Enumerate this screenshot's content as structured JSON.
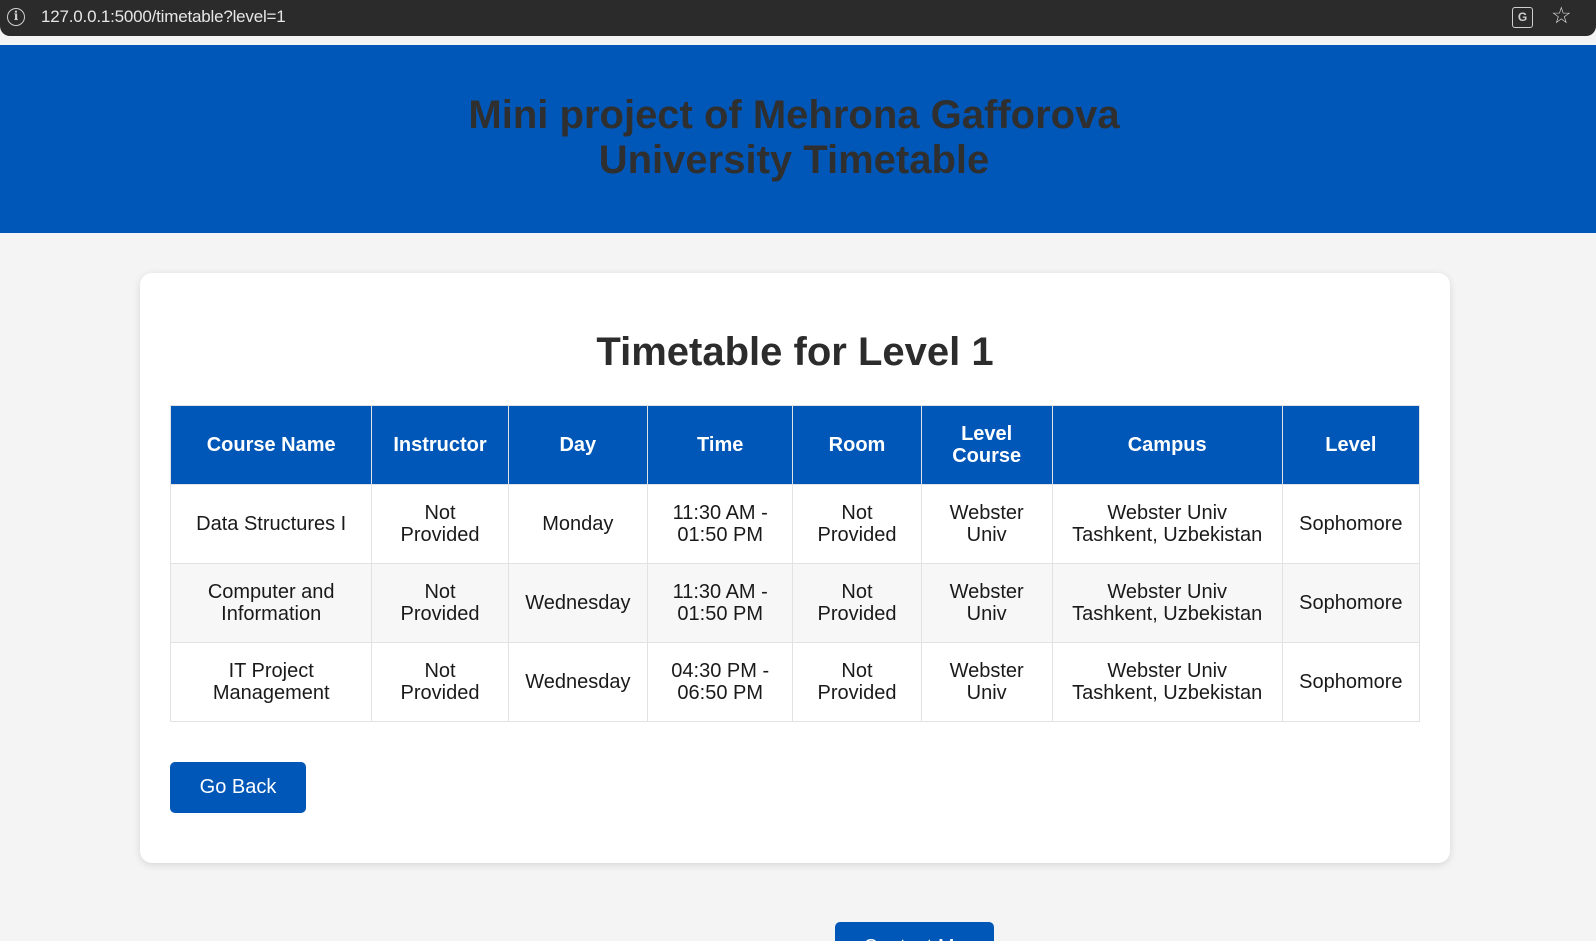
{
  "browser": {
    "url": "127.0.0.1:5000/timetable?level=1",
    "info_glyph": "i",
    "translate_glyph": "G",
    "star_glyph": "☆"
  },
  "header": {
    "title_line1": "Mini project of Mehrona Gafforova",
    "title_line2": "University Timetable"
  },
  "main": {
    "heading": "Timetable for Level 1",
    "columns": [
      "Course Name",
      "Instructor",
      "Day",
      "Time",
      "Room",
      "Level Course",
      "Campus",
      "Level"
    ],
    "rows": [
      [
        "Data Structures I",
        "Not Provided",
        "Monday",
        "11:30 AM - 01:50 PM",
        "Not Provided",
        "Webster Univ",
        "Webster Univ Tashkent, Uzbekistan",
        "Sophomore"
      ],
      [
        "Computer and Information",
        "Not Provided",
        "Wednesday",
        "11:30 AM - 01:50 PM",
        "Not Provided",
        "Webster Univ",
        "Webster Univ Tashkent, Uzbekistan",
        "Sophomore"
      ],
      [
        "IT Project Management",
        "Not Provided",
        "Wednesday",
        "04:30 PM - 06:50 PM",
        "Not Provided",
        "Webster Univ",
        "Webster Univ Tashkent, Uzbekistan",
        "Sophomore"
      ]
    ],
    "go_back_label": "Go Back"
  },
  "footer": {
    "contact_label": "Contact Me"
  },
  "colors": {
    "primary": "#0057b8",
    "background": "#f4f4f4",
    "card": "#ffffff"
  }
}
